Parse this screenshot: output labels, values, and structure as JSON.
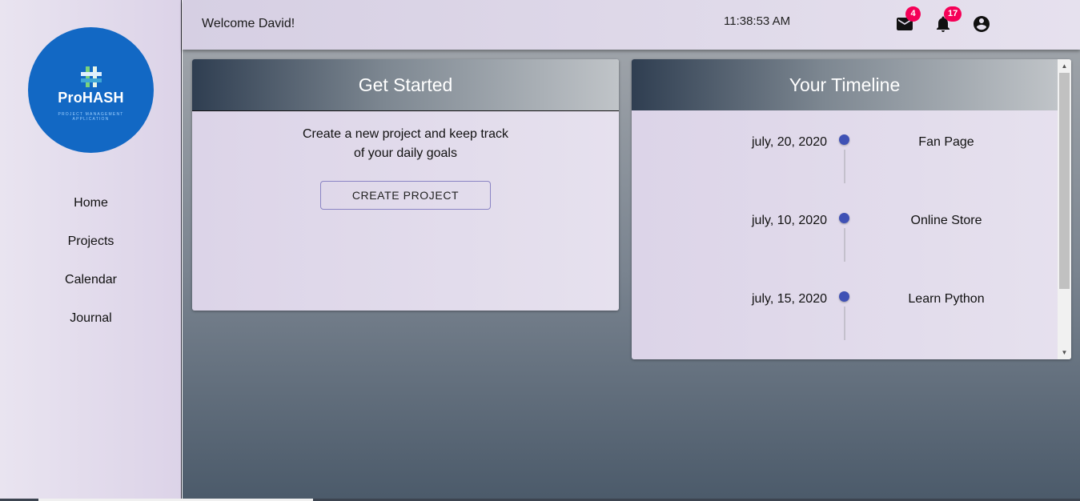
{
  "app": {
    "logo_name": "ProHASH",
    "logo_subtitle": "Project Management Application"
  },
  "sidebar": {
    "items": [
      {
        "label": "Home"
      },
      {
        "label": "Projects"
      },
      {
        "label": "Calendar"
      },
      {
        "label": "Journal"
      }
    ]
  },
  "header": {
    "welcome": "Welcome David!",
    "time": "11:38:53 AM",
    "mail_count": "4",
    "notification_count": "17",
    "icons": [
      "mail-icon",
      "bell-icon",
      "account-circle-icon"
    ]
  },
  "get_started": {
    "title": "Get Started",
    "line1": "Create a new project and keep track",
    "line2": "of your daily goals",
    "button_label": "CREATE PROJECT"
  },
  "timeline": {
    "title": "Your Timeline",
    "items": [
      {
        "date": "july, 20, 2020",
        "name": "Fan Page"
      },
      {
        "date": "july, 10, 2020",
        "name": "Online Store"
      },
      {
        "date": "july, 15, 2020",
        "name": "Learn Python"
      }
    ]
  },
  "colors": {
    "accent": "#3f51b5",
    "badge": "#f50057",
    "logo_bg": "#1268c4"
  }
}
